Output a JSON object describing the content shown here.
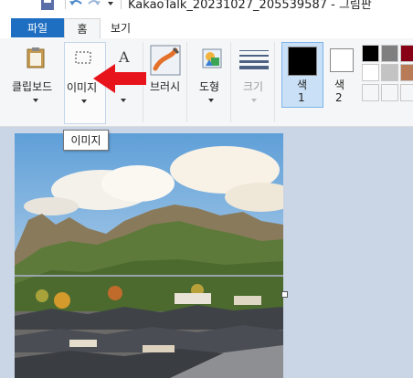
{
  "window": {
    "title": "KakaoTalk_20231027_205539587 - 그림판"
  },
  "tabs": [
    {
      "label": "파일"
    },
    {
      "label": "홈"
    },
    {
      "label": "보기"
    }
  ],
  "ribbon": {
    "clipboard_label": "클립보드",
    "image_label": "이미지",
    "brushes_label": "브러시",
    "shapes_label": "도형",
    "size_label": "크기",
    "color1_label": "색\n1",
    "color1_line1": "색",
    "color1_line2": "1",
    "color2_line1": "색",
    "color2_line2": "2"
  },
  "tooltip": {
    "text": "이미지"
  },
  "colors": {
    "accent": "#1e6fc2",
    "selected_group_bg": "#c9e0f7",
    "workspace": "#cad5e6",
    "arrow": "#e8141b",
    "color1": "#000000",
    "color2": "#ffffff",
    "palette": [
      "#000000",
      "#7f7f7f",
      "#880015",
      "#ffffff",
      "#c3c3c3",
      "#b97a57",
      "#ffffff",
      "#ffffff",
      "#ffffff"
    ]
  },
  "icons": [
    "save-icon",
    "undo-icon",
    "redo-icon",
    "clipboard-icon",
    "select-icon",
    "text-tool-icon",
    "brush-icon",
    "shapes-icon",
    "size-icon"
  ]
}
